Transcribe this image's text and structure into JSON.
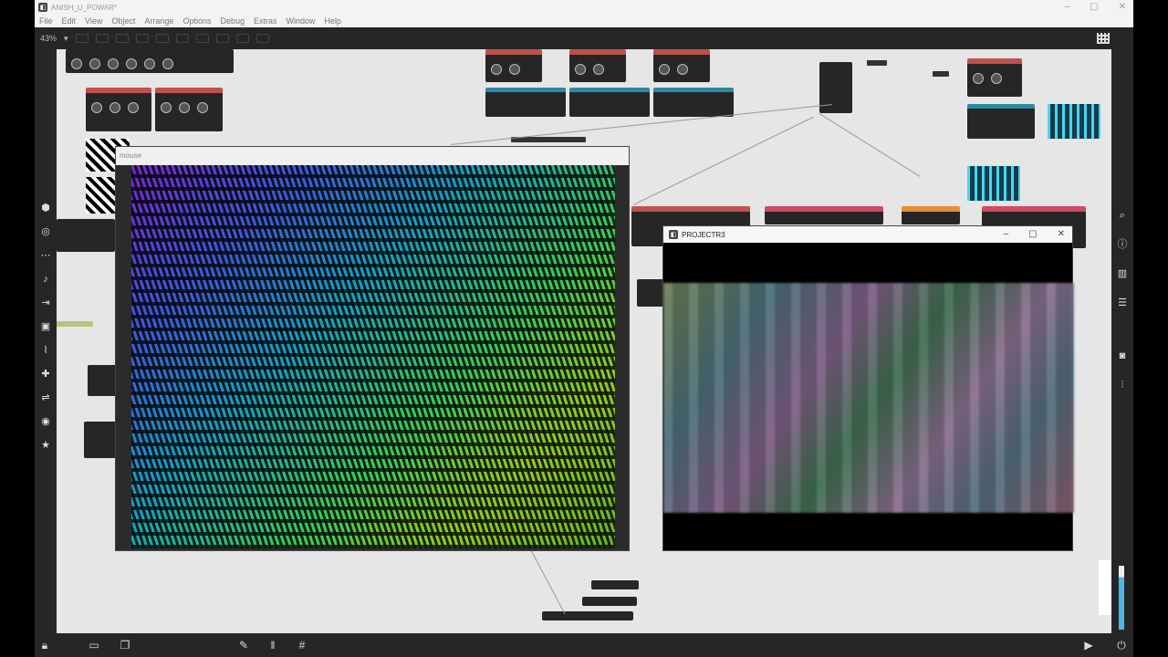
{
  "window": {
    "title": "ANISH_U_POWAR*",
    "controls": [
      "–",
      "▢",
      "✕"
    ]
  },
  "menu": [
    "File",
    "Edit",
    "View",
    "Object",
    "Arrange",
    "Options",
    "Debug",
    "Extras",
    "Window",
    "Help"
  ],
  "toolbar": {
    "zoom": "43%"
  },
  "windows": {
    "mouse": {
      "title": "mouse"
    },
    "projector": {
      "title": "PROJECTR3",
      "controls": [
        "–",
        "▢",
        "✕"
      ]
    }
  },
  "icons": {
    "left": [
      "cube-icon",
      "target-icon",
      "note-icon",
      "step-icon",
      "image-icon",
      "paperclip-icon",
      "puzzle-icon",
      "link-icon",
      "circle-icon",
      "star-icon"
    ],
    "right": [
      "search-icon",
      "info-icon",
      "book-icon",
      "list-icon",
      "camera-icon",
      "sliders-icon"
    ],
    "bottom": [
      "lock-icon",
      "presentation-icon",
      "windows-icon",
      "wrench-icon",
      "bars-icon",
      "grid-icon"
    ]
  },
  "colors": {
    "accent_red": "#c0504d",
    "accent_teal": "#2b8aa0",
    "accent_pink": "#d04a66",
    "accent_orange": "#e3902c",
    "wave": "#49d5f0"
  }
}
